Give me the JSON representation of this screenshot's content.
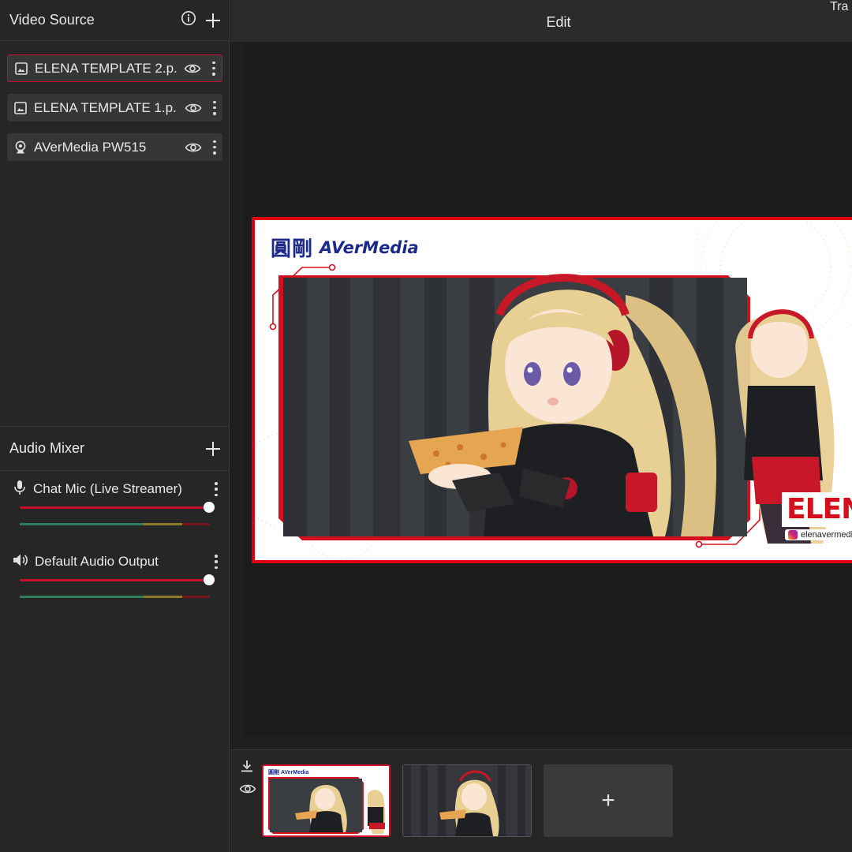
{
  "left_panel": {
    "video_source": {
      "title": "Video Source",
      "sources": [
        {
          "label": "ELENA TEMPLATE 2.p.",
          "type": "image",
          "active": true
        },
        {
          "label": "ELENA TEMPLATE 1.p.",
          "type": "image",
          "active": false
        },
        {
          "label": "AVerMedia PW515",
          "type": "webcam",
          "active": false
        }
      ]
    },
    "audio_mixer": {
      "title": "Audio Mixer",
      "channels": [
        {
          "label": "Chat Mic (Live Streamer)",
          "icon": "microphone-icon",
          "volume": 1.0
        },
        {
          "label": "Default Audio Output",
          "icon": "speaker-icon",
          "volume": 1.0
        }
      ]
    }
  },
  "top_bar": {
    "title": "Edit",
    "transition_label": "Tra"
  },
  "preview": {
    "logo_cn": "圓剛",
    "logo_brand": "AVerMedia",
    "name_text": "ELENA",
    "instagram_handle": "elenavermedia"
  },
  "scenes": {
    "thumb_logo": "圓剛 AVerMedia",
    "add_label": "+"
  },
  "colors": {
    "accent": "#c8102e",
    "panel": "#262626",
    "canvas": "#1c1c1c",
    "source_bg": "#363636"
  }
}
